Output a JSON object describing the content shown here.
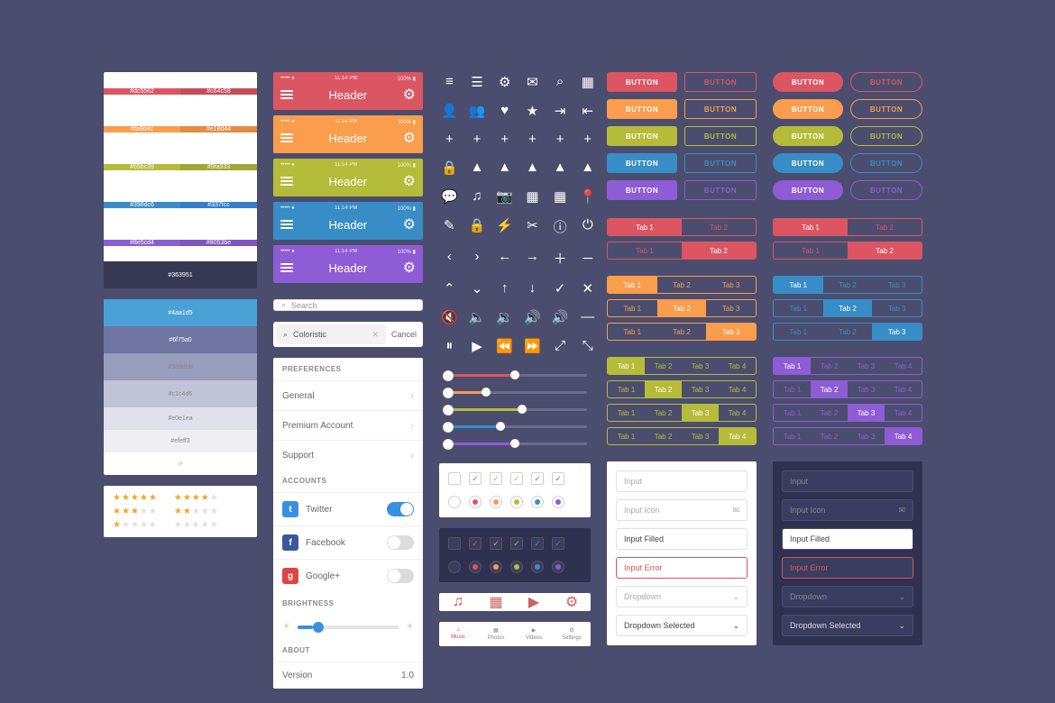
{
  "swatches": {
    "pairs": [
      [
        "#dc5562",
        "#c64c58"
      ],
      [
        "#fa9d4c",
        "#e18d44"
      ],
      [
        "#b5bc39",
        "#9fa933"
      ],
      [
        "#398dc6",
        "#337fcc"
      ],
      [
        "#8e5cd4",
        "#8053be"
      ]
    ],
    "dark": "#363951",
    "grays": [
      "#4aa1d5",
      "#6f75a0",
      "#989dbb",
      "#c1c4d6",
      "#e0e1ea",
      "#efeff3"
    ]
  },
  "headers": {
    "title": "Header",
    "time": "11:14 PM",
    "signal": "•••••",
    "carrier": "●",
    "pct": "100%",
    "colors": [
      "#dc5562",
      "#fa9d4c",
      "#b5bc39",
      "#398dc6",
      "#8e5cd4"
    ]
  },
  "search": {
    "placeholder": "Search",
    "typed": "Coloristic",
    "cancel": "Cancel"
  },
  "settings": {
    "prefs": "PREFERENCES",
    "general": "General",
    "premium": "Premium Account",
    "support": "Support",
    "accounts": "ACCOUNTS",
    "twitter": "Twitter",
    "facebook": "Facebook",
    "google": "Google+",
    "brightness": "BRIGHTNESS",
    "about": "ABOUT",
    "version": "Version",
    "version_val": "1.0"
  },
  "buttons": {
    "label": "BUTTON",
    "colors": [
      "#dc5562",
      "#fa9d4c",
      "#b5bc39",
      "#398dc6",
      "#8e5cd4"
    ]
  },
  "tabs2": {
    "t1": "Tab 1",
    "t2": "Tab 2"
  },
  "tabs3": {
    "t1": "Tab 1",
    "t2": "Tab 2",
    "t3": "Tab 3"
  },
  "tabs4": {
    "t1": "Tab 1",
    "t2": "Tab 2",
    "t3": "Tab 3",
    "t4": "Tab 4"
  },
  "inputs": {
    "empty": "Input",
    "icon": "Input Icon",
    "filled": "Input Filled",
    "error": "Input Error",
    "dropdown": "Dropdown",
    "dropdown_sel": "Dropdown Selected"
  },
  "nav": {
    "music": "Music",
    "photos": "Photos",
    "videos": "Videos",
    "settings": "Settings"
  },
  "accent_set": [
    "#36394f",
    "#dc5562",
    "#fa9d4c",
    "#b5bc39",
    "#398dc6",
    "#8e5cd4"
  ],
  "slider_colors": [
    "#dc5562",
    "#fa9d4c",
    "#b5bc39",
    "#398dc6",
    "#8e5cd4"
  ]
}
